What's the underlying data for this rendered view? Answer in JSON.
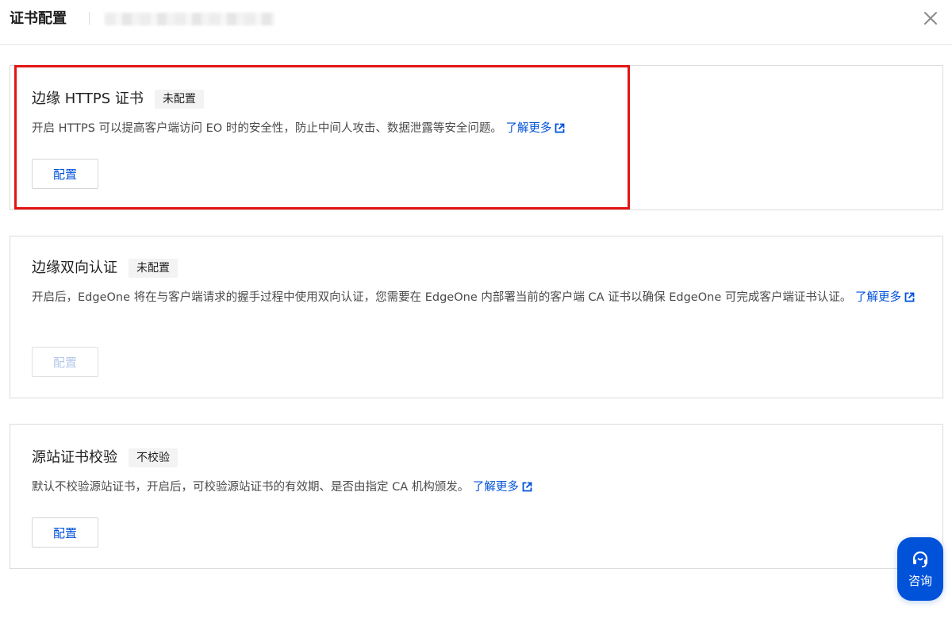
{
  "header": {
    "title": "证书配置"
  },
  "cards": [
    {
      "title": "边缘 HTTPS 证书",
      "tag": "未配置",
      "description": "开启 HTTPS 可以提高客户端访问 EO 时的安全性，防止中间人攻击、数据泄露等安全问题。",
      "link": "了解更多",
      "button": "配置"
    },
    {
      "title": "边缘双向认证",
      "tag": "未配置",
      "description": "开启后，EdgeOne 将在与客户端请求的握手过程中使用双向认证，您需要在 EdgeOne 内部署当前的客户端 CA 证书以确保 EdgeOne 可完成客户端证书认证。",
      "link": "了解更多",
      "button": "配置"
    },
    {
      "title": "源站证书校验",
      "tag": "不校验",
      "description": "默认不校验源站证书，开启后，可校验源站证书的有效期、是否由指定 CA 机构颁发。",
      "link": "了解更多",
      "button": "配置"
    }
  ],
  "consult": {
    "label": "咨询"
  },
  "colors": {
    "accent": "#0052d9",
    "highlight": "#e31414",
    "disabled": "#b5c7ea"
  }
}
